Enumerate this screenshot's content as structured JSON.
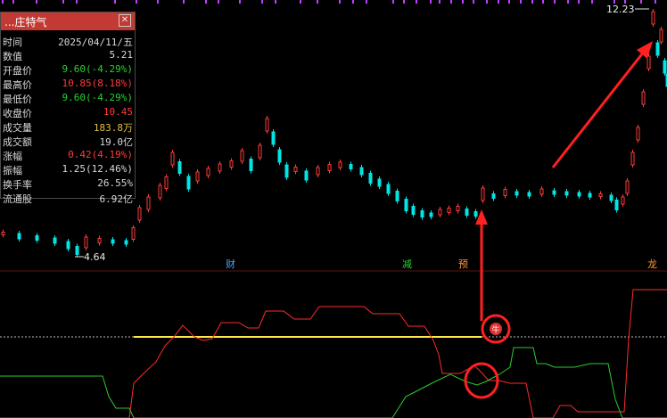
{
  "info_panel": {
    "title": "...庄特气",
    "rows": [
      {
        "label": "时间",
        "value": "2025/04/11/五",
        "color": "#d8d8d8"
      },
      {
        "label": "数值",
        "value": "5.21",
        "color": "#d8d8d8"
      },
      {
        "label": "开盘价",
        "value": "9.60(-4.29%)",
        "color": "#25d22c"
      },
      {
        "label": "最高价",
        "value": "10.85(8.18%)",
        "color": "#ff3b3b"
      },
      {
        "label": "最低价",
        "value": "9.60(-4.29%)",
        "color": "#25d22c"
      },
      {
        "label": "收盘价",
        "value": "10.45",
        "color": "#ff3b3b"
      },
      {
        "label": "成交量",
        "value": "183.8万",
        "color": "#e0c040"
      },
      {
        "label": "成交额",
        "value": "19.0亿",
        "color": "#d8d8d8"
      },
      {
        "label": "涨幅",
        "value": "0.42(4.19%)",
        "color": "#ff3b3b"
      },
      {
        "label": "振幅",
        "value": "1.25(12.46%)",
        "color": "#d8d8d8"
      },
      {
        "label": "换手率",
        "value": "26.55%",
        "color": "#d8d8d8"
      },
      {
        "label": "流通股",
        "value": "6.92亿",
        "color": "#d8d8d8"
      }
    ]
  },
  "price_labels": {
    "high": "12.23",
    "low": "4.64"
  },
  "event_markers": [
    {
      "text": "财",
      "color": "#4aa3ff"
    },
    {
      "text": "减",
      "color": "#25d22c"
    },
    {
      "text": "预",
      "color": "#ff9a30"
    },
    {
      "text": "龙",
      "color": "#ff9a30"
    }
  ],
  "signal_badge": "牛",
  "colors": {
    "up": "#ff3b3b",
    "down": "#00e5e5",
    "green_line": "#2ecc2e",
    "yellow_line": "#ffe84a",
    "annotation": "#ff2020",
    "top_ticks": "#c040ff"
  }
}
